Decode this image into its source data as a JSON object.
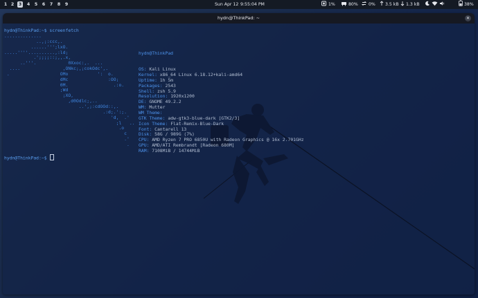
{
  "topbar": {
    "workspaces": [
      "1",
      "2",
      "3",
      "4",
      "5",
      "6",
      "7",
      "8",
      "9"
    ],
    "active_workspace": "3",
    "date": "Sun Apr 12",
    "time": "9:55:04 PM",
    "cpu": "1%",
    "memory": "80%",
    "swap": "0%",
    "upload": "3.5 kB",
    "download": "1.3 kB",
    "battery": "38%"
  },
  "window": {
    "title": "hydn@ThinkPad: ~"
  },
  "terminal": {
    "prompt": "hydn@ThinkPad:~$",
    "command": "screenfetch",
    "logo_lines": [
      "..............",
      "            ..,;:ccc,.",
      "          ......''';lxO.",
      ".....''''..........,:ld;",
      "           .';;;;::;,,.x,",
      "      ..'''.            0Xxoc:,.  ...",
      "  ....                ,ONkc;,;cokOdc',.",
      " .                   OMo           ':  o.",
      "                     dMc               :OO;",
      "                     0M.                 .:o.",
      "                     ;Wd",
      "                      ;XO,",
      "                        ,d0Odlc;,..",
      "                            ..',;:cdOOd::,.",
      "                                     .:d;.':;.",
      "                                        'd,  .'",
      "                                          ;l   ..",
      "                                           .o",
      "                                             c",
      "                                             .'",
      "                                              ."
    ],
    "user_host": "hydn@ThinkPad",
    "info": [
      {
        "key": "OS:",
        "value": "Kali Linux"
      },
      {
        "key": "Kernel:",
        "value": "x86_64 Linux 6.18.12+kali-amd64"
      },
      {
        "key": "Uptime:",
        "value": "1h 5m"
      },
      {
        "key": "Packages:",
        "value": "2543"
      },
      {
        "key": "Shell:",
        "value": "zsh 5.9"
      },
      {
        "key": "Resolution:",
        "value": "1920x1200"
      },
      {
        "key": "DE:",
        "value": "GNOME 49.2.2"
      },
      {
        "key": "WM:",
        "value": "Mutter"
      },
      {
        "key": "WM Theme:",
        "value": ""
      },
      {
        "key": "GTK Theme:",
        "value": "adw-gtk3-blue-dark [GTK2/3]"
      },
      {
        "key": "Icon Theme:",
        "value": "Flat-Remix-Blue-Dark"
      },
      {
        "key": "Font:",
        "value": "Cantarell 13"
      },
      {
        "key": "Disk:",
        "value": "58G / 989G (7%)"
      },
      {
        "key": "CPU:",
        "value": "AMD Ryzen 7 PRO 6850U with Radeon Graphics @ 16x 2.701GHz"
      },
      {
        "key": "GPU:",
        "value": "AMD/ATI Rembrandt [Radeon 680M]"
      },
      {
        "key": "RAM:",
        "value": "7108MiB / 14744MiB"
      }
    ]
  },
  "colors": {
    "topbar_bg": "#141a24",
    "accent_blue": "#4d93ec",
    "terminal_text": "#b3bfd3",
    "background": "#13244a"
  }
}
